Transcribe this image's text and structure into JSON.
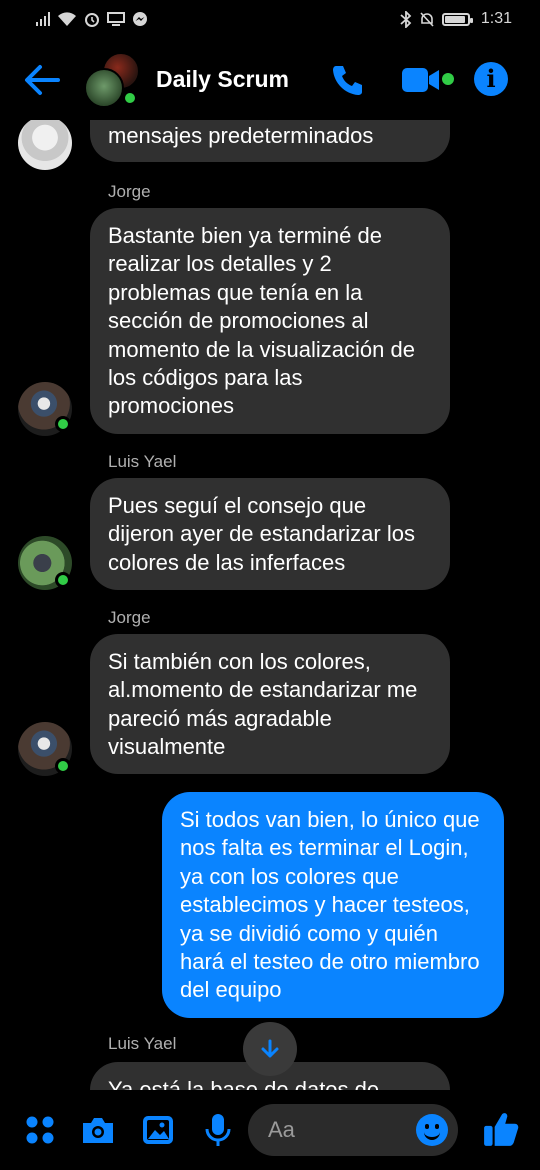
{
  "status_bar": {
    "time": "1:31"
  },
  "header": {
    "title": "Daily Scrum"
  },
  "messages": [
    {
      "id": "m0",
      "sender": "",
      "text": "mensajes predeterminados"
    },
    {
      "id": "m1",
      "sender": "Jorge",
      "text": "Bastante bien ya terminé de realizar los detalles y 2 problemas que tenía en la sección de promociones al momento de la visualización de los códigos para las promociones"
    },
    {
      "id": "m2",
      "sender": "Luis Yael",
      "text": "Pues seguí el consejo que dijeron ayer de estandarizar los colores de las inferfaces"
    },
    {
      "id": "m3",
      "sender": "Jorge",
      "text": "Si también con los colores, al.momento de estandarizar me pareció más agradable visualmente"
    },
    {
      "id": "m4",
      "sender": "",
      "text": "Si todos van bien, lo único que nos falta es terminar el Login, ya con los colores que establecimos y hacer testeos, ya se dividió como y quién hará el testeo de otro miembro del equipo"
    },
    {
      "id": "m5",
      "sender": "Luis Yael",
      "text": "Ya está la base de datos de"
    }
  ],
  "composer": {
    "placeholder": "Aa"
  },
  "colors": {
    "accent": "#0a84ff",
    "online": "#31cc46",
    "bubble_incoming": "#303030",
    "background": "#000000"
  }
}
